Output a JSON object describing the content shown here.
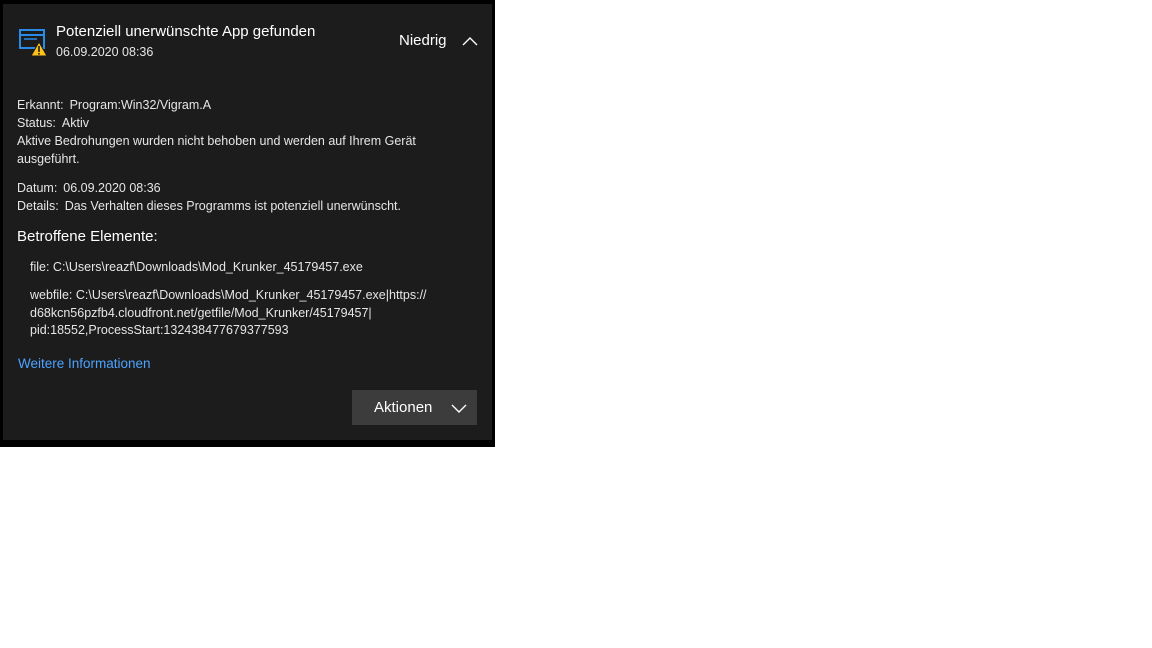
{
  "notification": {
    "title": "Potenziell unerwünschte App gefunden",
    "timestamp": "06.09.2020 08:36",
    "severity": "Niedrig",
    "icon": "app-window-warning-icon",
    "collapse_icon": "chevron-up-icon"
  },
  "details": {
    "detected_label": "Erkannt:",
    "detected_value": "Program:Win32/Vigram.A",
    "status_label": "Status:",
    "status_value": "Aktiv",
    "description_line1": "Aktive Bedrohungen wurden nicht behoben und werden auf Ihrem Gerät",
    "description_line2": "ausgeführt.",
    "date_label": "Datum:",
    "date_value": "06.09.2020 08:36",
    "details_label": "Details:",
    "details_value": "Das Verhalten dieses Programms ist potenziell unerwünscht."
  },
  "affected": {
    "heading": "Betroffene Elemente:",
    "file": "file: C:\\Users\\reazf\\Downloads\\Mod_Krunker_45179457.exe",
    "webfile_line1": "webfile: C:\\Users\\reazf\\Downloads\\Mod_Krunker_45179457.exe|https://",
    "webfile_line2": "d68kcn56pzfb4.cloudfront.net/getfile/Mod_Krunker/45179457|",
    "webfile_line3": "pid:18552,ProcessStart:132438477679377593"
  },
  "more_info_link": "Weitere Informationen",
  "actions_button": "Aktionen",
  "colors": {
    "card_bg": "#1c1c1c",
    "accent_blue": "#4ca3ff",
    "icon_blue": "#2a8ae6",
    "warning_yellow": "#ffc21a",
    "button_bg": "#3c3c3c"
  }
}
